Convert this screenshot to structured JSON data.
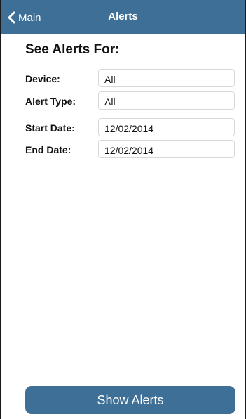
{
  "navbar": {
    "back_label": "Main",
    "back_icon": "chevron-left-icon",
    "title": "Alerts"
  },
  "form": {
    "heading": "See Alerts For:",
    "fields": [
      {
        "label": "Device:",
        "value": "All"
      },
      {
        "label": "Alert Type:",
        "value": "All"
      },
      {
        "label": "Start Date:",
        "value": "12/02/2014"
      },
      {
        "label": "End Date:",
        "value": "12/02/2014"
      }
    ]
  },
  "actions": {
    "show_alerts_label": "Show Alerts"
  },
  "colors": {
    "accent": "#3e6f97",
    "text": "#111111",
    "field_border": "#d8d8d8"
  }
}
